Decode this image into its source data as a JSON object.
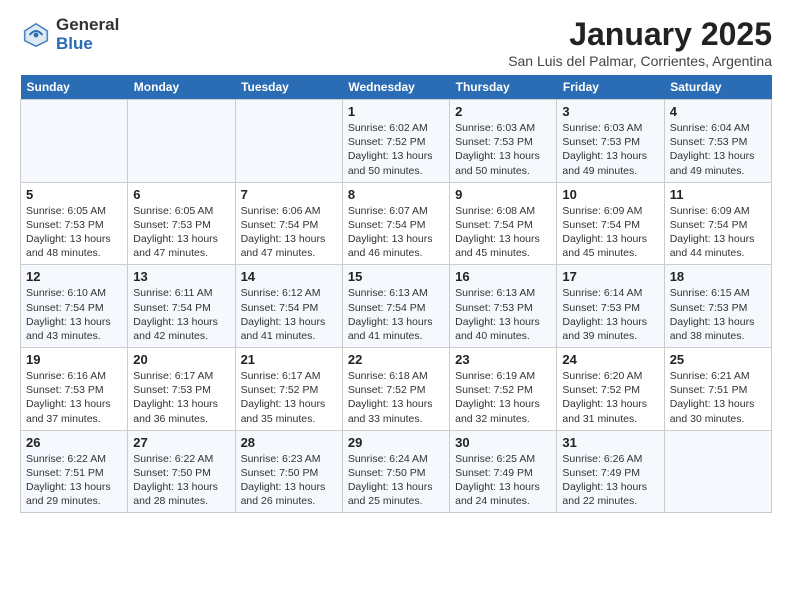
{
  "header": {
    "logo_general": "General",
    "logo_blue": "Blue",
    "title": "January 2025",
    "subtitle": "San Luis del Palmar, Corrientes, Argentina"
  },
  "days_of_week": [
    "Sunday",
    "Monday",
    "Tuesday",
    "Wednesday",
    "Thursday",
    "Friday",
    "Saturday"
  ],
  "weeks": [
    [
      {
        "day": "",
        "info": ""
      },
      {
        "day": "",
        "info": ""
      },
      {
        "day": "",
        "info": ""
      },
      {
        "day": "1",
        "info": "Sunrise: 6:02 AM\nSunset: 7:52 PM\nDaylight: 13 hours\nand 50 minutes."
      },
      {
        "day": "2",
        "info": "Sunrise: 6:03 AM\nSunset: 7:53 PM\nDaylight: 13 hours\nand 50 minutes."
      },
      {
        "day": "3",
        "info": "Sunrise: 6:03 AM\nSunset: 7:53 PM\nDaylight: 13 hours\nand 49 minutes."
      },
      {
        "day": "4",
        "info": "Sunrise: 6:04 AM\nSunset: 7:53 PM\nDaylight: 13 hours\nand 49 minutes."
      }
    ],
    [
      {
        "day": "5",
        "info": "Sunrise: 6:05 AM\nSunset: 7:53 PM\nDaylight: 13 hours\nand 48 minutes."
      },
      {
        "day": "6",
        "info": "Sunrise: 6:05 AM\nSunset: 7:53 PM\nDaylight: 13 hours\nand 47 minutes."
      },
      {
        "day": "7",
        "info": "Sunrise: 6:06 AM\nSunset: 7:54 PM\nDaylight: 13 hours\nand 47 minutes."
      },
      {
        "day": "8",
        "info": "Sunrise: 6:07 AM\nSunset: 7:54 PM\nDaylight: 13 hours\nand 46 minutes."
      },
      {
        "day": "9",
        "info": "Sunrise: 6:08 AM\nSunset: 7:54 PM\nDaylight: 13 hours\nand 45 minutes."
      },
      {
        "day": "10",
        "info": "Sunrise: 6:09 AM\nSunset: 7:54 PM\nDaylight: 13 hours\nand 45 minutes."
      },
      {
        "day": "11",
        "info": "Sunrise: 6:09 AM\nSunset: 7:54 PM\nDaylight: 13 hours\nand 44 minutes."
      }
    ],
    [
      {
        "day": "12",
        "info": "Sunrise: 6:10 AM\nSunset: 7:54 PM\nDaylight: 13 hours\nand 43 minutes."
      },
      {
        "day": "13",
        "info": "Sunrise: 6:11 AM\nSunset: 7:54 PM\nDaylight: 13 hours\nand 42 minutes."
      },
      {
        "day": "14",
        "info": "Sunrise: 6:12 AM\nSunset: 7:54 PM\nDaylight: 13 hours\nand 41 minutes."
      },
      {
        "day": "15",
        "info": "Sunrise: 6:13 AM\nSunset: 7:54 PM\nDaylight: 13 hours\nand 41 minutes."
      },
      {
        "day": "16",
        "info": "Sunrise: 6:13 AM\nSunset: 7:53 PM\nDaylight: 13 hours\nand 40 minutes."
      },
      {
        "day": "17",
        "info": "Sunrise: 6:14 AM\nSunset: 7:53 PM\nDaylight: 13 hours\nand 39 minutes."
      },
      {
        "day": "18",
        "info": "Sunrise: 6:15 AM\nSunset: 7:53 PM\nDaylight: 13 hours\nand 38 minutes."
      }
    ],
    [
      {
        "day": "19",
        "info": "Sunrise: 6:16 AM\nSunset: 7:53 PM\nDaylight: 13 hours\nand 37 minutes."
      },
      {
        "day": "20",
        "info": "Sunrise: 6:17 AM\nSunset: 7:53 PM\nDaylight: 13 hours\nand 36 minutes."
      },
      {
        "day": "21",
        "info": "Sunrise: 6:17 AM\nSunset: 7:52 PM\nDaylight: 13 hours\nand 35 minutes."
      },
      {
        "day": "22",
        "info": "Sunrise: 6:18 AM\nSunset: 7:52 PM\nDaylight: 13 hours\nand 33 minutes."
      },
      {
        "day": "23",
        "info": "Sunrise: 6:19 AM\nSunset: 7:52 PM\nDaylight: 13 hours\nand 32 minutes."
      },
      {
        "day": "24",
        "info": "Sunrise: 6:20 AM\nSunset: 7:52 PM\nDaylight: 13 hours\nand 31 minutes."
      },
      {
        "day": "25",
        "info": "Sunrise: 6:21 AM\nSunset: 7:51 PM\nDaylight: 13 hours\nand 30 minutes."
      }
    ],
    [
      {
        "day": "26",
        "info": "Sunrise: 6:22 AM\nSunset: 7:51 PM\nDaylight: 13 hours\nand 29 minutes."
      },
      {
        "day": "27",
        "info": "Sunrise: 6:22 AM\nSunset: 7:50 PM\nDaylight: 13 hours\nand 28 minutes."
      },
      {
        "day": "28",
        "info": "Sunrise: 6:23 AM\nSunset: 7:50 PM\nDaylight: 13 hours\nand 26 minutes."
      },
      {
        "day": "29",
        "info": "Sunrise: 6:24 AM\nSunset: 7:50 PM\nDaylight: 13 hours\nand 25 minutes."
      },
      {
        "day": "30",
        "info": "Sunrise: 6:25 AM\nSunset: 7:49 PM\nDaylight: 13 hours\nand 24 minutes."
      },
      {
        "day": "31",
        "info": "Sunrise: 6:26 AM\nSunset: 7:49 PM\nDaylight: 13 hours\nand 22 minutes."
      },
      {
        "day": "",
        "info": ""
      }
    ]
  ]
}
